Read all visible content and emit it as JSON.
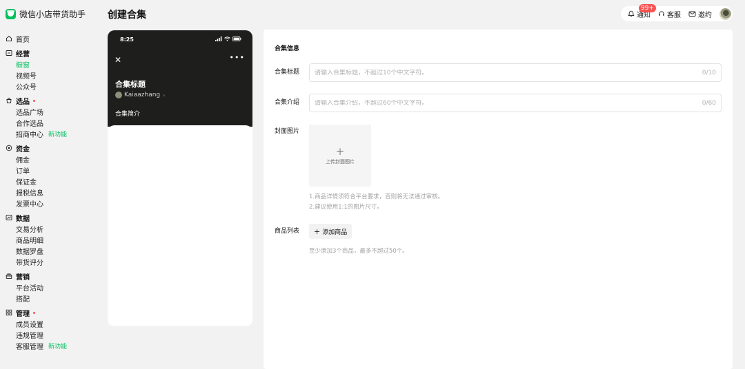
{
  "app": {
    "name": "微信小店带货助手",
    "accent": "#07c160"
  },
  "page_title": "创建合集",
  "topbar": {
    "notify_label": "通知",
    "notify_badge": "99+",
    "service_label": "客服",
    "invite_label": "邀约"
  },
  "sidebar": {
    "home": "首页",
    "groups": [
      {
        "label": "经营",
        "icon": "minus-square-icon",
        "items": [
          "橱窗",
          "视频号",
          "公众号"
        ]
      },
      {
        "label": "选品",
        "icon": "bag-icon",
        "items": [
          "选品广场",
          "合作选品",
          "招商中心"
        ]
      },
      {
        "label": "资金",
        "icon": "circle-dot-icon",
        "items": [
          "佣金",
          "订单",
          "保证金",
          "报税信息",
          "发票中心"
        ]
      },
      {
        "label": "数据",
        "icon": "chart-icon",
        "items": [
          "交易分析",
          "商品明细",
          "数据罗盘",
          "带货评分"
        ]
      },
      {
        "label": "营销",
        "icon": "gift-icon",
        "items": [
          "平台活动",
          "搭配"
        ]
      },
      {
        "label": "管理",
        "icon": "grid-icon",
        "items": [
          "成员设置",
          "违规管理",
          "客服管理"
        ]
      }
    ],
    "new_tag": "新功能"
  },
  "preview": {
    "time": "8:25",
    "title": "合集标题",
    "user": "Kaiaazhang",
    "desc_label": "合集简介"
  },
  "form": {
    "section_title": "合集信息",
    "title_label": "合集标题",
    "title_placeholder": "请输入合集标题，不超过10个中文字符。",
    "title_counter": "0/10",
    "intro_label": "合集介绍",
    "intro_placeholder": "请输入合集介绍，不超过60个中文字符。",
    "intro_counter": "0/60",
    "cover_label": "封面图片",
    "cover_upload": "上传封面图片",
    "cover_hint_1": "1.商品详情须符合平台要求，否则将无法通过审核。",
    "cover_hint_2": "2.建议使用1:1的图片尺寸。",
    "products_label": "商品列表",
    "add_product": "添加商品",
    "products_hint": "至少添加3个商品，最多不超过50个。"
  }
}
